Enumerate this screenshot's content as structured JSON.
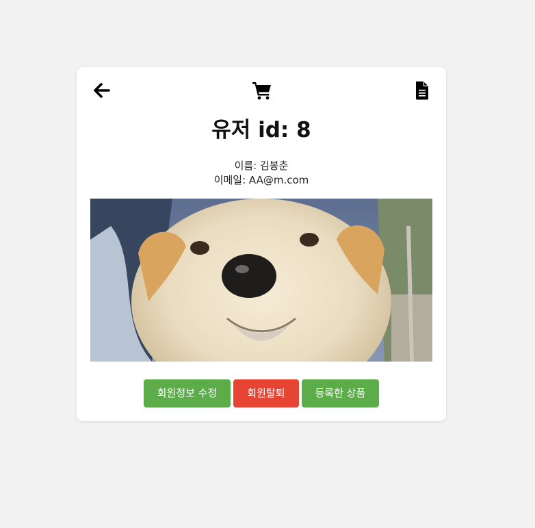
{
  "user": {
    "title": "유저 id: 8",
    "name_line": "이름: 김봉춘",
    "email_line": "이메일: AA@m.com"
  },
  "icons": {
    "back": "arrow-left-icon",
    "cart": "shopping-cart-icon",
    "document": "file-text-icon"
  },
  "actions": {
    "edit_label": "회원정보 수정",
    "withdraw_label": "회원탈퇴",
    "products_label": "등록한 상품"
  },
  "colors": {
    "edit_button": "#5cad4a",
    "withdraw_button": "#e84434",
    "products_button": "#5cad4a",
    "background": "#f2f2f2",
    "card": "#ffffff"
  }
}
